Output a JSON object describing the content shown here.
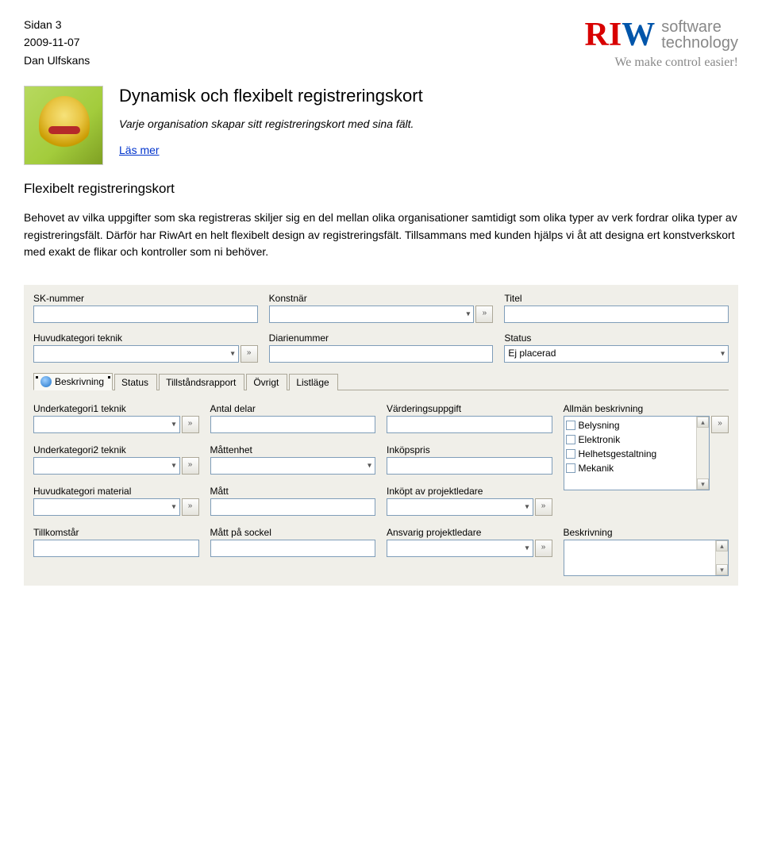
{
  "page_meta": {
    "page_label": "Sidan 3",
    "date": "2009-11-07",
    "author": "Dan Ulfskans"
  },
  "logo": {
    "brand_abbrev": "RIW",
    "line1": "software",
    "line2": "technology",
    "tagline": "We make control easier!"
  },
  "article": {
    "title": "Dynamisk och flexibelt registreringskort",
    "lead": "Varje organisation skapar sitt registreringskort med sina fält.",
    "read_more": "Läs mer",
    "subtitle": "Flexibelt registreringskort",
    "body": "Behovet av vilka uppgifter som ska registreras skiljer sig en del mellan olika organisationer samtidigt som olika typer av verk fordrar olika typer av registreringsfält. Därför har RiwArt en helt flexibelt design av registreringsfält. Tillsammans med kunden hjälps vi åt att designa ert konstverkskort med exakt de flikar och kontroller som ni behöver."
  },
  "form": {
    "top": {
      "sk_nummer": "SK-nummer",
      "konstnar": "Konstnär",
      "titel": "Titel",
      "huvudkategori_teknik": "Huvudkategori teknik",
      "diarienummer": "Diarienummer",
      "status": "Status",
      "status_value": "Ej placerad"
    },
    "tabs": [
      "Beskrivning",
      "Status",
      "Tillståndsrapport",
      "Övrigt",
      "Listläge"
    ],
    "lower": {
      "underkategori1_teknik": "Underkategori1 teknik",
      "antal_delar": "Antal delar",
      "varderingsuppgift": "Värderingsuppgift",
      "allman_beskrivning": "Allmän beskrivning",
      "underkategori2_teknik": "Underkategori2 teknik",
      "mattenhet": "Måttenhet",
      "inkopspris": "Inköpspris",
      "huvudkategori_material": "Huvudkategori material",
      "matt": "Mått",
      "inkopt_av_projektledare": "Inköpt av projektledare",
      "tillkomstar": "Tillkomstår",
      "matt_pa_sockel": "Mått på sockel",
      "ansvarig_projektledare": "Ansvarig projektledare",
      "beskrivning": "Beskrivning",
      "list_items": [
        "Belysning",
        "Elektronik",
        "Helhetsgestaltning",
        "Mekanik"
      ]
    },
    "icon_label": "»"
  }
}
